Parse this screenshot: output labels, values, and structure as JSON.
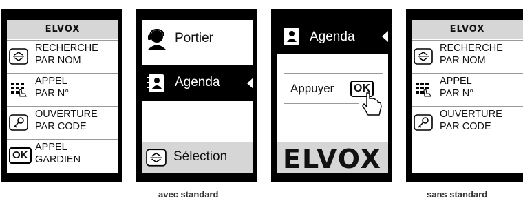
{
  "logo": "ELVOX",
  "menu": {
    "search": [
      "RECHERCHE",
      "PAR NOM"
    ],
    "call_number": [
      "APPEL",
      "PAR N°"
    ],
    "opening": [
      "OUVERTURE",
      "PAR CODE"
    ],
    "call_guard": [
      "APPEL",
      "GARDIEN"
    ]
  },
  "screen2": {
    "portier": "Portier",
    "agenda": "Agenda",
    "selection": "Sélection"
  },
  "screen3": {
    "agenda": "Agenda",
    "press": "Appuyer",
    "ok": "OK"
  },
  "ok_key": "OK",
  "captions": {
    "with": "avec standard",
    "without": "sans standard"
  }
}
